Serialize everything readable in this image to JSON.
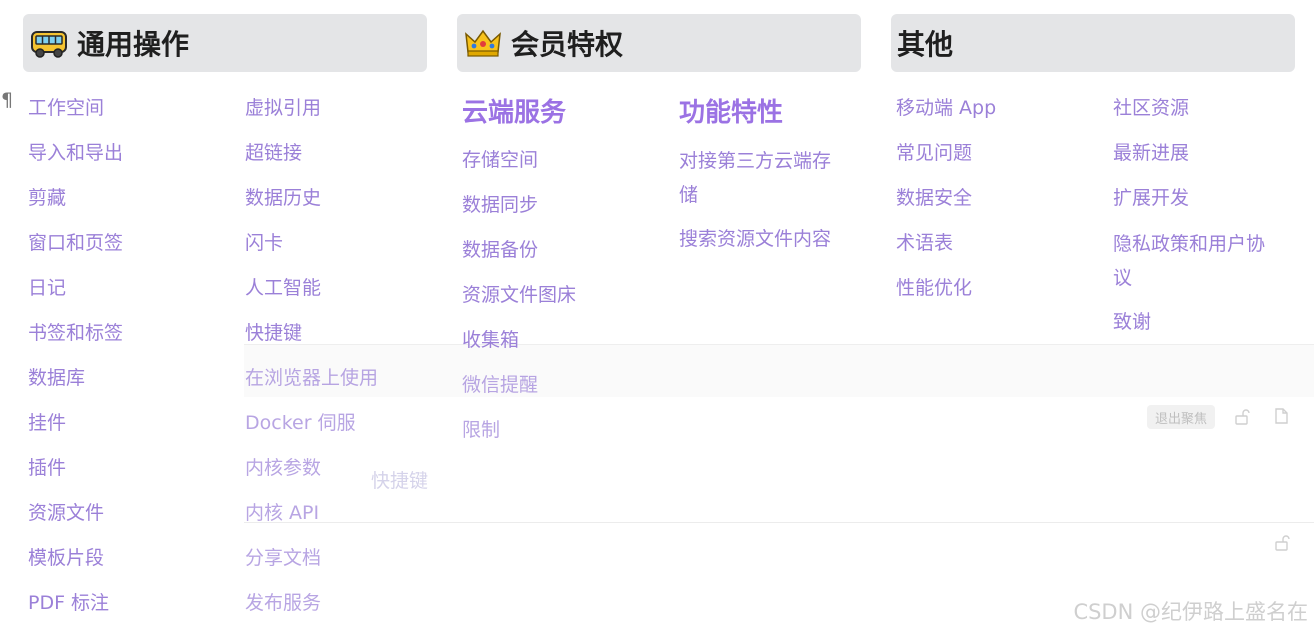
{
  "sections": {
    "general": {
      "title": "通用操作",
      "col1": [
        "工作空间",
        "导入和导出",
        "剪藏",
        "窗口和页签",
        "日记",
        "书签和标签",
        "数据库",
        "挂件",
        "插件",
        "资源文件",
        "模板片段",
        "PDF 标注"
      ],
      "col2": [
        "虚拟引用",
        "超链接",
        "数据历史",
        "闪卡",
        "人工智能",
        "快捷键",
        "在浏览器上使用",
        "Docker 伺服",
        "内核参数",
        "内核 API",
        "分享文档",
        "发布服务"
      ]
    },
    "membership": {
      "title": "会员特权",
      "cloud": {
        "heading": "云端服务",
        "items": [
          "存储空间",
          "数据同步",
          "数据备份",
          "资源文件图床",
          "收集箱",
          "微信提醒",
          "限制"
        ]
      },
      "features": {
        "heading": "功能特性",
        "items": [
          "对接第三方云端存储",
          "搜索资源文件内容"
        ]
      }
    },
    "other": {
      "title": "其他",
      "col1": [
        "移动端 App",
        "常见问题",
        "数据安全",
        "术语表",
        "性能优化"
      ],
      "col2": [
        "社区资源",
        "最新进展",
        "扩展开发",
        "隐私政策和用户协议",
        "致谢"
      ]
    }
  },
  "overlay": {
    "ghost_text": "快捷键",
    "exit_focus": "退出聚焦",
    "pilcrow": "¶"
  },
  "watermark": "CSDN @纪伊路上盛名在",
  "icons": [
    "bus-emoji-icon",
    "crown-emoji-icon",
    "lock-open-icon",
    "document-icon"
  ],
  "colors": {
    "link": "#9b80d8",
    "subheading": "#9b72e4",
    "header_bg": "#e4e5e7"
  }
}
